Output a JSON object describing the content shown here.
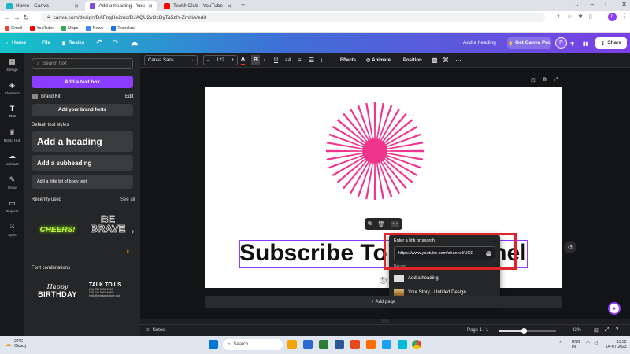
{
  "browser": {
    "tabs": [
      {
        "label": "Home - Canva",
        "color": "#1fb6c4"
      },
      {
        "label": "Add a heading - Youtube Banner",
        "color": "#7d4cdb"
      },
      {
        "label": "TechNClub - YouTube",
        "color": "#ff0000"
      }
    ],
    "url": "canva.com/design/DAFnqHe2mo/DJAQU2vOcDyTa5zlY-ZmHA/edit",
    "bookmarks": [
      "Gmail",
      "YouTube",
      "Maps",
      "News",
      "Translate"
    ],
    "profile_initial": "P"
  },
  "header": {
    "home": "Home",
    "file": "File",
    "resize": "Resize",
    "design_title": "Add a heading",
    "get_pro": "Get Canva Pro",
    "avatar": "P",
    "share": "Share"
  },
  "rail": [
    {
      "label": "Design",
      "icon": "layout-icon"
    },
    {
      "label": "Elements",
      "icon": "shapes-icon"
    },
    {
      "label": "Text",
      "icon": "text-icon"
    },
    {
      "label": "Brand Hub",
      "icon": "brand-icon"
    },
    {
      "label": "Uploads",
      "icon": "upload-icon"
    },
    {
      "label": "Draw",
      "icon": "pen-icon"
    },
    {
      "label": "Projects",
      "icon": "folder-icon"
    },
    {
      "label": "Apps",
      "icon": "apps-icon"
    }
  ],
  "panel": {
    "search_placeholder": "Search text",
    "add_text_box": "Add a text box",
    "brand_kit": "Brand Kit",
    "edit": "Edit",
    "add_brand_fonts": "Add your brand fonts",
    "default_styles": "Default text styles",
    "heading": "Add a heading",
    "subheading": "Add a subheading",
    "body": "Add a little bit of body text",
    "recently_used": "Recently used",
    "see_all": "See all",
    "recent1": "CHEERS!",
    "recent2_line1": "BE",
    "recent2_line2": "BRAVE",
    "font_combinations": "Font combinations",
    "combo1_line1": "Happy",
    "combo1_line2": "BIRTHDAY",
    "combo2_title": "TALK TO US",
    "combo2_l1": "(01) 234 5555 2000",
    "combo2_l2": "+78 234 5562 4095",
    "combo2_l3": "hello@reallygreatsite.com"
  },
  "toolbar": {
    "font": "Canva Sans",
    "font_size": "122",
    "effects": "Effects",
    "animate": "Animate",
    "position": "Position"
  },
  "canvas": {
    "headline": "Subscribe To My Channel",
    "add_page": "+ Add page"
  },
  "link_popup": {
    "label": "Enter a link or search",
    "url_value": "https://www.youtube.com/channel/UCE",
    "section": "Recent",
    "items": [
      "Add a heading",
      "Your Story - Untitled Design"
    ]
  },
  "bottom": {
    "notes": "Notes",
    "page": "Page 1 / 1",
    "zoom": "43%"
  },
  "taskbar": {
    "temp": "29°C",
    "weather": "Cloudy",
    "search": "Search",
    "lang": "ENG",
    "region": "IN",
    "time": "13:52",
    "date": "04-07-2023"
  },
  "colors": {
    "accent": "#8b3dff",
    "highlight_box": "#e0242b",
    "starburst": "#f0358c"
  }
}
